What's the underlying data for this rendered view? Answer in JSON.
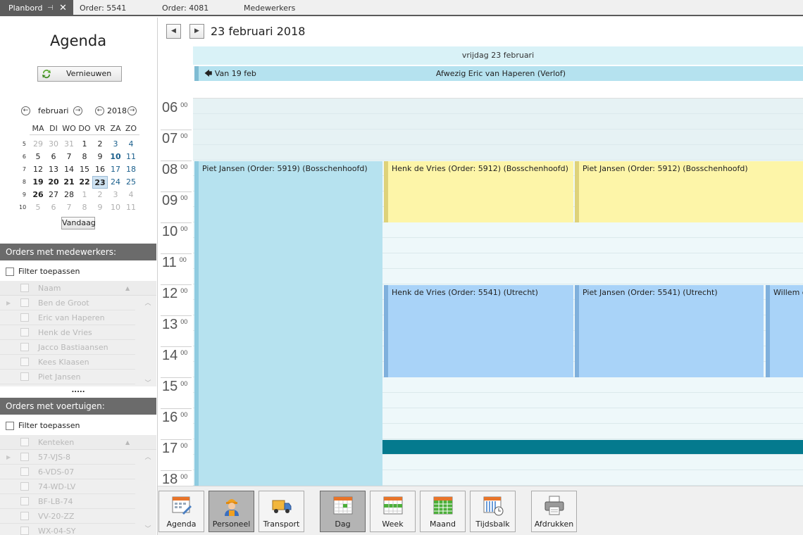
{
  "tabs": [
    {
      "label": "Planbord",
      "active": true
    },
    {
      "label": "Order: 5541"
    },
    {
      "label": "Order: 4081"
    },
    {
      "label": "Medewerkers"
    }
  ],
  "tab_pin_glyph": "⊣",
  "tab_close_glyph": "✕",
  "left": {
    "title": "Agenda",
    "refresh_label": "Vernieuwen",
    "calendar": {
      "month": "februari",
      "year": "2018",
      "prev_glyph": "←",
      "next_glyph": "→",
      "weekdays": [
        "MA",
        "DI",
        "WO",
        "DO",
        "VR",
        "ZA",
        "ZO"
      ],
      "weeks": [
        {
          "nr": "5",
          "days": [
            "29",
            "30",
            "31",
            "1",
            "2",
            "3",
            "4"
          ]
        },
        {
          "nr": "6",
          "days": [
            "5",
            "6",
            "7",
            "8",
            "9",
            "10",
            "11"
          ]
        },
        {
          "nr": "7",
          "days": [
            "12",
            "13",
            "14",
            "15",
            "16",
            "17",
            "18"
          ]
        },
        {
          "nr": "8",
          "days": [
            "19",
            "20",
            "21",
            "22",
            "23",
            "24",
            "25"
          ]
        },
        {
          "nr": "9",
          "days": [
            "26",
            "27",
            "28",
            "1",
            "2",
            "3",
            "4"
          ]
        },
        {
          "nr": "10",
          "days": [
            "5",
            "6",
            "7",
            "8",
            "9",
            "10",
            "11"
          ]
        }
      ],
      "today_label": "Vandaag",
      "selected_day": "23"
    },
    "orders_employees": {
      "header": "Orders met medewerkers:",
      "filter_label": "Filter toepassen",
      "column": "Naam",
      "rows": [
        "Ben de Groot",
        "Eric van Haperen",
        "Henk de Vries",
        "Jacco Bastiaansen",
        "Kees Klaasen",
        "Piet Jansen"
      ]
    },
    "splitter": ".....",
    "orders_vehicles": {
      "header": "Orders met voertuigen:",
      "filter_label": "Filter toepassen",
      "column": "Kenteken",
      "rows": [
        "57-VJS-8",
        "6-VDS-07",
        "74-WD-LV",
        "BF-LB-74",
        "VV-20-ZZ",
        "WX-04-SY"
      ]
    }
  },
  "main": {
    "prev_glyph": "◀",
    "next_glyph": "▶",
    "date_title": "23 februari 2018",
    "day_header": "vrijdag 23 februari",
    "allday": {
      "from_label": "🡄 Van 19 feb",
      "subject": "Afwezig Eric van Haperen (Verlof)"
    },
    "hours": [
      "06",
      "07",
      "08",
      "09",
      "10",
      "11",
      "12",
      "13",
      "14",
      "15",
      "16",
      "17",
      "18"
    ],
    "minutes": "00",
    "appointments": [
      {
        "text": "Piet Jansen (Order: 5919) (Bosschenhoofd)",
        "color": "#b6e2ef",
        "bar": "#8fcbe0"
      },
      {
        "text": "Henk de Vries (Order: 5912) (Bosschenhoofd)",
        "color": "#fdf5a8",
        "bar": "#ded27a"
      },
      {
        "text": "Piet Jansen (Order: 5912) (Bosschenhoofd)",
        "color": "#fdf5a8",
        "bar": "#ded27a"
      },
      {
        "text": "Henk de Vries (Order: 5541) (Utrecht)",
        "color": "#a9d3f8",
        "bar": "#7fb0dc"
      },
      {
        "text": "Piet Jansen (Order: 5541) (Utrecht)",
        "color": "#a9d3f8",
        "bar": "#7fb0dc"
      },
      {
        "text": "Willem de",
        "color": "#a9d3f8",
        "bar": "#7fb0dc"
      },
      {
        "text": "",
        "color": "#047a8e",
        "bar": "#047a8e"
      }
    ]
  },
  "toolbar": {
    "buttons": [
      {
        "label": "Agenda",
        "icon": "calendar-edit-icon"
      },
      {
        "label": "Personeel",
        "icon": "worker-icon",
        "active": true
      },
      {
        "label": "Transport",
        "icon": "truck-icon"
      },
      {
        "label": "Dag",
        "icon": "day-view-icon",
        "active": true
      },
      {
        "label": "Week",
        "icon": "week-view-icon"
      },
      {
        "label": "Maand",
        "icon": "month-view-icon"
      },
      {
        "label": "Tijdsbalk",
        "icon": "timeline-icon"
      },
      {
        "label": "Afdrukken",
        "icon": "printer-icon"
      }
    ]
  },
  "colors": {
    "accent_teal": "#047a8e",
    "section_header": "#6b6b6b",
    "day_header_bg": "#d9f2f7"
  }
}
